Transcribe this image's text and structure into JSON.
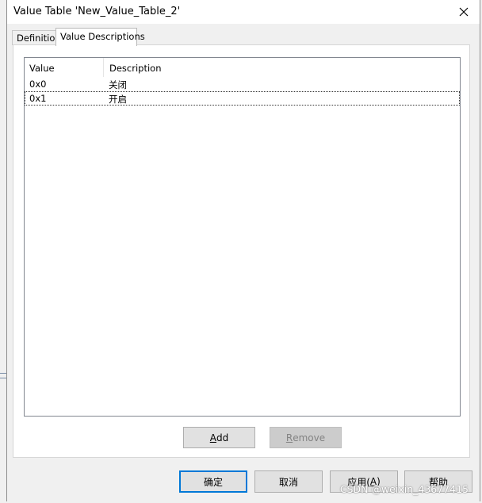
{
  "window": {
    "title": "Value Table 'New_Value_Table_2'",
    "close_icon": "close-icon"
  },
  "tabs": [
    {
      "label": "Definition",
      "active": false
    },
    {
      "label": "Value Descriptions",
      "active": true
    }
  ],
  "table": {
    "columns": [
      "Value",
      "Description"
    ],
    "rows": [
      {
        "value": "0x0",
        "description": "关闭"
      },
      {
        "value": "0x1",
        "description": "开启"
      }
    ],
    "focused_row": 1
  },
  "panel_buttons": {
    "add": {
      "label": "Add",
      "mnemonic": "A",
      "rest": "dd",
      "enabled": true
    },
    "remove": {
      "label": "Remove",
      "mnemonic": "R",
      "rest": "emove",
      "enabled": false
    }
  },
  "dialog_buttons": {
    "ok": "确定",
    "cancel": "取消",
    "apply": {
      "label": "应用(A)",
      "prefix": "应用(",
      "mnemonic": "A",
      "suffix": ")"
    },
    "help": "帮助"
  },
  "watermark": "CSDN @weixin_43677415",
  "colors": {
    "focus_border": "#0078d7",
    "disabled_text": "#838383"
  }
}
